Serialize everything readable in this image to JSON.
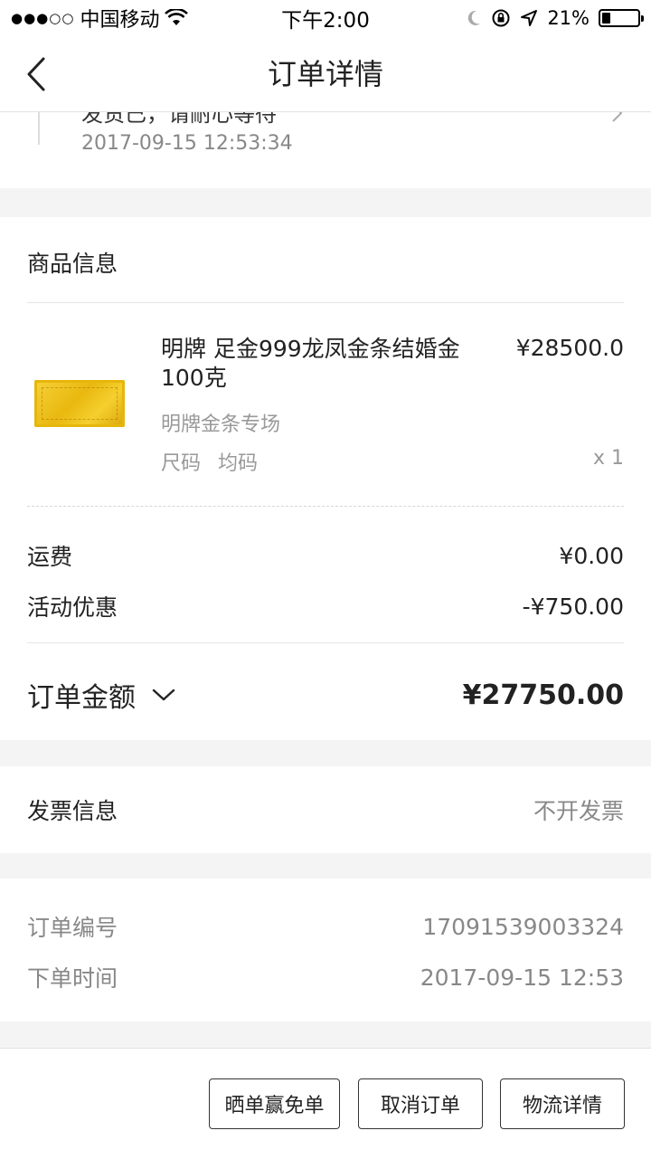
{
  "status_bar": {
    "carrier": "中国移动",
    "time": "下午2:00",
    "battery": "21%"
  },
  "nav": {
    "title": "订单详情"
  },
  "logistics": {
    "status_text": "发货已，请耐心等待",
    "time": "2017-09-15 12:53:34"
  },
  "goods": {
    "section_title": "商品信息",
    "product": {
      "name": "明牌 足金999龙凤金条结婚金100克",
      "price": "¥28500.0",
      "shop": "明牌金条专场",
      "spec_label": "尺码",
      "spec_value": "均码",
      "quantity": "x 1"
    },
    "shipping_label": "运费",
    "shipping_value": "¥0.00",
    "discount_label": "活动优惠",
    "discount_value": "-¥750.00",
    "total_label": "订单金额",
    "total_value": "¥27750.00"
  },
  "invoice": {
    "label": "发票信息",
    "value": "不开发票"
  },
  "order": {
    "number_label": "订单编号",
    "number_value": "17091539003324",
    "time_label": "下单时间",
    "time_value": "2017-09-15 12:53"
  },
  "actions": {
    "share_label": "晒单赢免单",
    "cancel_label": "取消订单",
    "logistics_label": "物流详情"
  },
  "colors": {
    "background": "#f4f4f4",
    "card": "#ffffff",
    "text": "#222222",
    "muted": "#888888",
    "gold": "#f2c523"
  }
}
